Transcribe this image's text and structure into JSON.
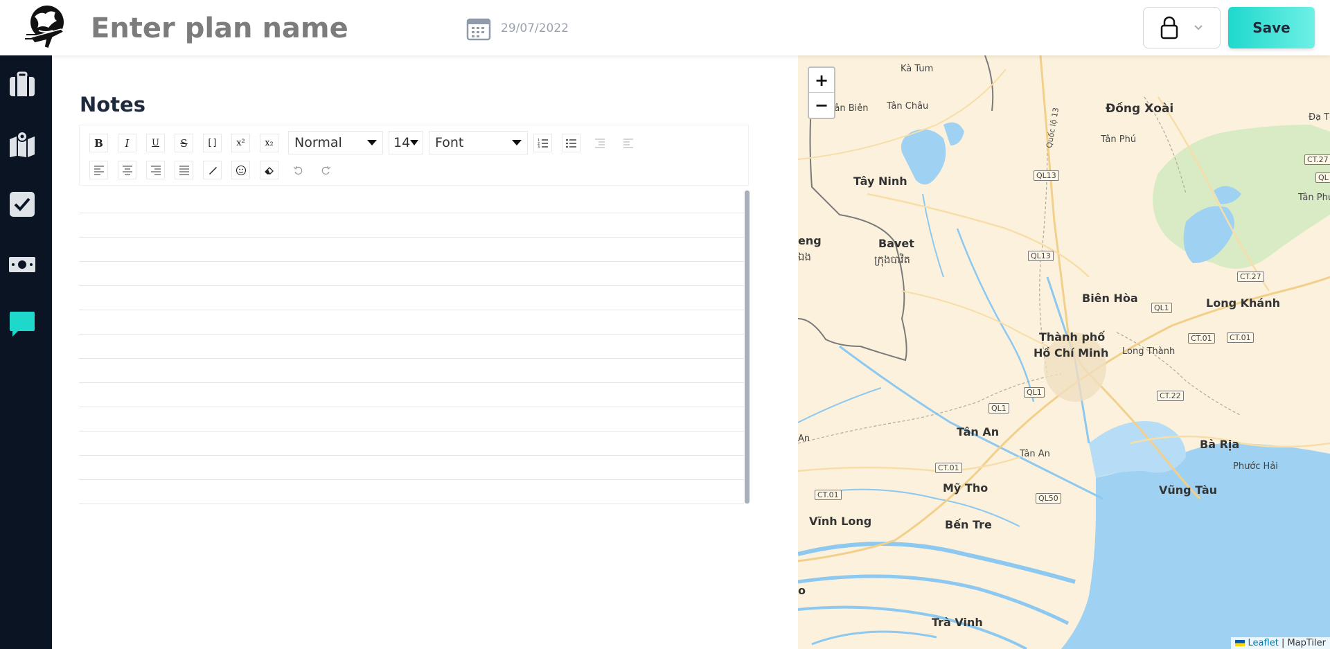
{
  "header": {
    "plan_name_placeholder": "Enter plan name",
    "date": "29/07/2022",
    "save_label": "Save"
  },
  "sidebar": {
    "items": [
      {
        "name": "suitcase-icon",
        "active": false
      },
      {
        "name": "map-icon",
        "active": false
      },
      {
        "name": "checklist-icon",
        "active": false
      },
      {
        "name": "money-icon",
        "active": false
      },
      {
        "name": "chat-icon",
        "active": true
      }
    ]
  },
  "notes": {
    "title": "Notes",
    "toolbar": {
      "header_select": "Normal",
      "size_select": "14",
      "font_select": "Font"
    }
  },
  "map": {
    "labels": {
      "ka_tum": "Kà Tum",
      "dong_xoai": "Đồng Xoài",
      "da_te": "Đạ Tẻ",
      "tan_bien": "Tân Biên",
      "tan_chau": "Tân Châu",
      "tan_phu": "Tân Phú",
      "tay_ninh": "Tây Ninh",
      "bavet": "Bavet",
      "bavet_khmer": "ក្រុងបាវិត",
      "eng": "eng",
      "eng_khmer": "ឯង",
      "tan_phu_2": "Tân Phú",
      "bien_hoa": "Biên Hòa",
      "long_khanh": "Long Khánh",
      "thanh_pho": "Thành phố",
      "ho_chi_minh": "Hồ Chí Minh",
      "long_thanh": "Long Thành",
      "tan_an": "Tân An",
      "tan_an_2": "Tân An",
      "ba_ria": "Bà Rịa",
      "phuoc_hai": "Phước Hải",
      "my_tho": "Mỹ Tho",
      "vung_tau": "Vũng Tàu",
      "vinh_long": "Vĩnh Long",
      "ben_tre": "Bến Tre",
      "tra_vinh": "Trà Vinh",
      "quoc_lo": "Quốc lộ 13",
      "an_edge": "An",
      "o_edge": "o"
    },
    "roads": [
      "QL13",
      "QL13",
      "CT.27",
      "QL",
      "CT.27",
      "QL1",
      "CT.01",
      "CT.01",
      "QL1",
      "QL1",
      "CT.22",
      "CT.01",
      "CT.01",
      "QL50"
    ],
    "attribution_link": "Leaflet",
    "attribution_text": "| MapTiler"
  },
  "colors": {
    "sidebar_bg": "#0b1423",
    "accent": "#1fd8cc",
    "water": "#8cc8f0",
    "land": "#fbf1dc"
  }
}
